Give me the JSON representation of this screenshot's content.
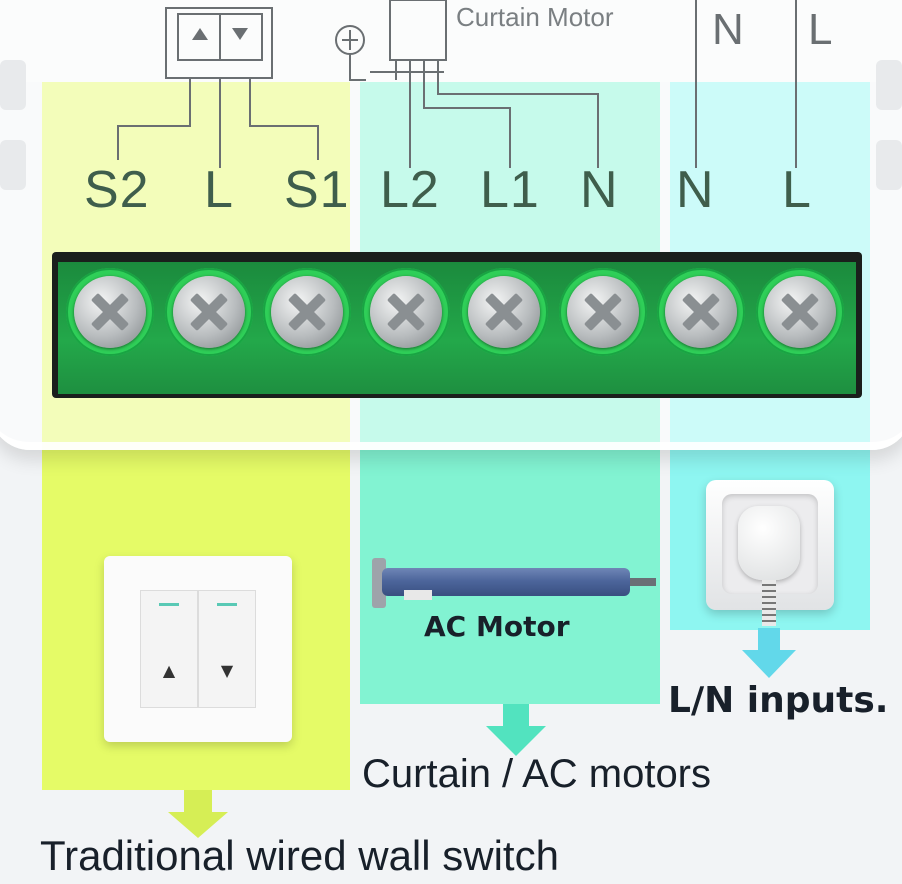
{
  "wiring_diagram": {
    "header_label": "Curtain Motor",
    "header_n": "N",
    "header_l": "L"
  },
  "terminals": [
    "S2",
    "L",
    "S1",
    "L2",
    "L1",
    "N",
    "N",
    "L"
  ],
  "devices": {
    "ac_motor_label": "AC Motor"
  },
  "captions": {
    "inputs": "L/N inputs.",
    "curtain": "Curtain / AC motors",
    "switch": "Traditional wired wall switch"
  },
  "colors": {
    "switch_zone": "#e4fb5a",
    "motor_zone": "#6ff2cb",
    "input_zone": "#7cf6f0",
    "pcb_green": "#23a84a"
  }
}
